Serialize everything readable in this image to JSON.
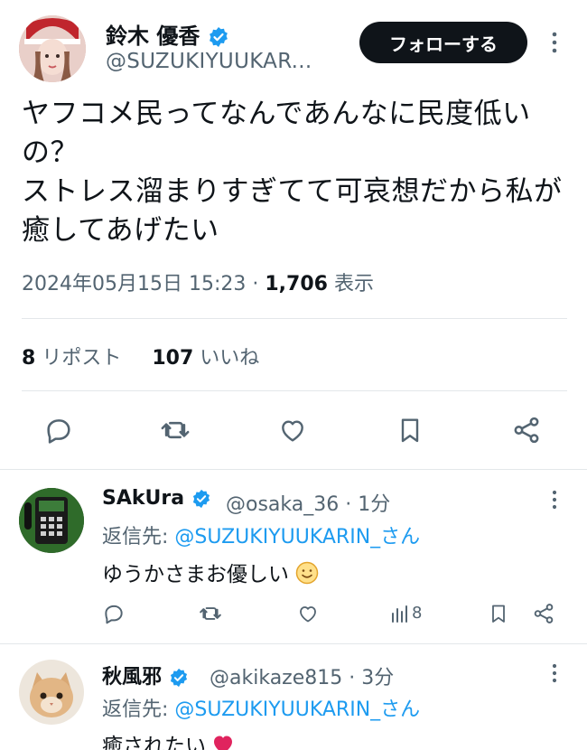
{
  "main_tweet": {
    "display_name": "鈴木 優香",
    "handle": "@SUZUKIYUUKAR...",
    "follow_label": "フォローする",
    "text": "ヤフコメ民ってなんであんなに民度低いの？\nストレス溜まりすぎてて可哀想だから私が癒してあげたい",
    "timestamp": "2024年05月15日 15:23",
    "separator": "·",
    "views_count": "1,706",
    "views_label": "表示",
    "reposts_count": "8",
    "reposts_label": "リポスト",
    "likes_count": "107",
    "likes_label": "いいね",
    "actions": [
      "reply-icon",
      "retweet-icon",
      "like-icon",
      "bookmark-icon",
      "share-icon"
    ]
  },
  "replies": [
    {
      "display_name": "SAkUra",
      "handle": "@osaka_36 · 1分",
      "reply_to_label": "返信先:",
      "reply_to_mention": "@SUZUKIYUUKARIN_さん",
      "text": "ゆうかさまお優しい",
      "emoji": "smiling-face-icon",
      "views_count": "8"
    },
    {
      "display_name": "秋風邪",
      "handle": "@akikaze815 · 3分",
      "reply_to_label": "返信先:",
      "reply_to_mention": "@SUZUKIYUUKARIN_さん",
      "text": "癒されたい",
      "emoji": "red-heart-icon"
    }
  ],
  "colors": {
    "accent": "#1d9bf0",
    "text_primary": "#0f1419",
    "text_secondary": "#536471",
    "divider": "#e3e7ea",
    "follow_button": "#0f1419",
    "heart_emoji": "#e0245e"
  }
}
